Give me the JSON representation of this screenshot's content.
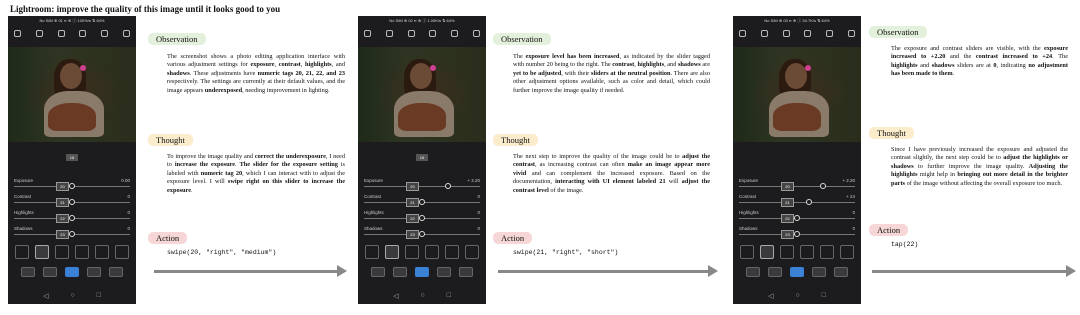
{
  "title": "Lightroom: improve the quality of this image until it looks good to you",
  "steps": [
    {
      "phone": {
        "status": "No SIM ⊕ 01 ▪▪ ⊕ ⓘ 100%/s ⇅ 64%",
        "tag": "18",
        "sliders": [
          {
            "name": "Exposure",
            "value": "0.00",
            "tag": "20",
            "pos": 0.5
          },
          {
            "name": "Contrast",
            "value": "0",
            "tag": "21",
            "pos": 0.5
          },
          {
            "name": "Highlights",
            "value": "0",
            "tag": "22",
            "pos": 0.5
          },
          {
            "name": "Shadows",
            "value": "0",
            "tag": "23",
            "pos": 0.5
          }
        ]
      },
      "observation_label": "Observation",
      "observation": [
        {
          "t": "The screenshot shows a photo editing application interface with various adjustment settings for "
        },
        {
          "t": "exposure",
          "b": true
        },
        {
          "t": ", "
        },
        {
          "t": "contrast",
          "b": true
        },
        {
          "t": ", "
        },
        {
          "t": "highlights",
          "b": true
        },
        {
          "t": ", and "
        },
        {
          "t": "shadows",
          "b": true
        },
        {
          "t": ". These adjustments have "
        },
        {
          "t": "numeric tags 20, 21, 22, and 23",
          "b": true
        },
        {
          "t": " respectively. The settings are currently at their default values, and the image appears "
        },
        {
          "t": "underexposed",
          "b": true
        },
        {
          "t": ", needing improvement in lighting."
        }
      ],
      "thought_label": "Thought",
      "thought": [
        {
          "t": "To improve the image quality and "
        },
        {
          "t": "correct the underexposure",
          "b": true
        },
        {
          "t": ", I need to "
        },
        {
          "t": "increase the exposure",
          "b": true
        },
        {
          "t": ". "
        },
        {
          "t": "The slider for the exposure setting",
          "b": true
        },
        {
          "t": " is labeled with "
        },
        {
          "t": "numeric tag 20",
          "b": true
        },
        {
          "t": ", which I can interact with to adjust the exposure level. I will "
        },
        {
          "t": "swipe right on this slider to increase the exposure",
          "b": true
        },
        {
          "t": "."
        }
      ],
      "action_label": "Action",
      "action": "swipe(20, \"right\", \"medium\")"
    },
    {
      "phone": {
        "status": "No SIM ⊕ 02 ▪▪ ⊕ ⓘ 1.00K/s ⇅ 64%",
        "tag": "18",
        "sliders": [
          {
            "name": "Exposure",
            "value": "+ 2.20",
            "tag": "20",
            "pos": 0.72
          },
          {
            "name": "Contrast",
            "value": "0",
            "tag": "21",
            "pos": 0.5
          },
          {
            "name": "Highlights",
            "value": "0",
            "tag": "22",
            "pos": 0.5
          },
          {
            "name": "Shadows",
            "value": "0",
            "tag": "23",
            "pos": 0.5
          }
        ]
      },
      "observation_label": "Observation",
      "observation": [
        {
          "t": "The "
        },
        {
          "t": "exposure level has been increased",
          "b": true
        },
        {
          "t": ", as indicated by the slider tagged with number 20 being to the right. The "
        },
        {
          "t": "contrast",
          "b": true
        },
        {
          "t": ", "
        },
        {
          "t": "highlights",
          "b": true
        },
        {
          "t": ", and "
        },
        {
          "t": "shadows",
          "b": true
        },
        {
          "t": " are "
        },
        {
          "t": "yet to be adjusted",
          "b": true
        },
        {
          "t": ", with their "
        },
        {
          "t": "sliders at the neutral position",
          "b": true
        },
        {
          "t": ". There are also other adjustment options available, such as color and detail, which could further improve the image quality if needed."
        }
      ],
      "thought_label": "Thought",
      "thought": [
        {
          "t": "The next step to improve the quality of the image could be to "
        },
        {
          "t": "adjust the contrast",
          "b": true
        },
        {
          "t": ", as increasing contrast can often "
        },
        {
          "t": "make an image appear more vivid",
          "b": true
        },
        {
          "t": " and can complement the increased exposure. Based on the documentation, "
        },
        {
          "t": "interacting with UI element labeled 21",
          "b": true
        },
        {
          "t": " will "
        },
        {
          "t": "adjust the contrast level",
          "b": true
        },
        {
          "t": " of the image."
        }
      ],
      "action_label": "Action",
      "action": "swipe(21, \"right\", \"short\")"
    },
    {
      "phone": {
        "status": "No SIM ⊕ 03 ▪▪ ⊕ ⓘ 34.7K/s ⇅ 64%",
        "tag": "",
        "sliders": [
          {
            "name": "Exposure",
            "value": "+ 2.20",
            "tag": "20",
            "pos": 0.72
          },
          {
            "name": "Contrast",
            "value": "+ 24",
            "tag": "21",
            "pos": 0.6
          },
          {
            "name": "Highlights",
            "value": "0",
            "tag": "22",
            "pos": 0.5
          },
          {
            "name": "Shadows",
            "value": "0",
            "tag": "23",
            "pos": 0.5
          }
        ]
      },
      "observation_label": "Observation",
      "observation": [
        {
          "t": "The exposure and contrast sliders are visible, with the "
        },
        {
          "t": "exposure increased to +2.20",
          "b": true
        },
        {
          "t": " and the "
        },
        {
          "t": "contrast increased to +24",
          "b": true
        },
        {
          "t": ". The "
        },
        {
          "t": "highlights",
          "b": true
        },
        {
          "t": " and "
        },
        {
          "t": "shadows",
          "b": true
        },
        {
          "t": " sliders are at "
        },
        {
          "t": "0",
          "b": true
        },
        {
          "t": ", indicating "
        },
        {
          "t": "no adjustment has been made to them",
          "b": true
        },
        {
          "t": "."
        }
      ],
      "thought_label": "Thought",
      "thought": [
        {
          "t": "Since I have previously increased the exposure and adjusted the contrast slightly, the next step could be to "
        },
        {
          "t": "adjust the highlights or shadows",
          "b": true
        },
        {
          "t": " to further improve the image quality. "
        },
        {
          "t": "Adjusting the highlights",
          "b": true
        },
        {
          "t": " might help in "
        },
        {
          "t": "bringing out more detail in the brighter parts",
          "b": true
        },
        {
          "t": " of the image without affecting the overall exposure too much."
        }
      ],
      "action_label": "Action",
      "action": "tap(22)"
    }
  ]
}
